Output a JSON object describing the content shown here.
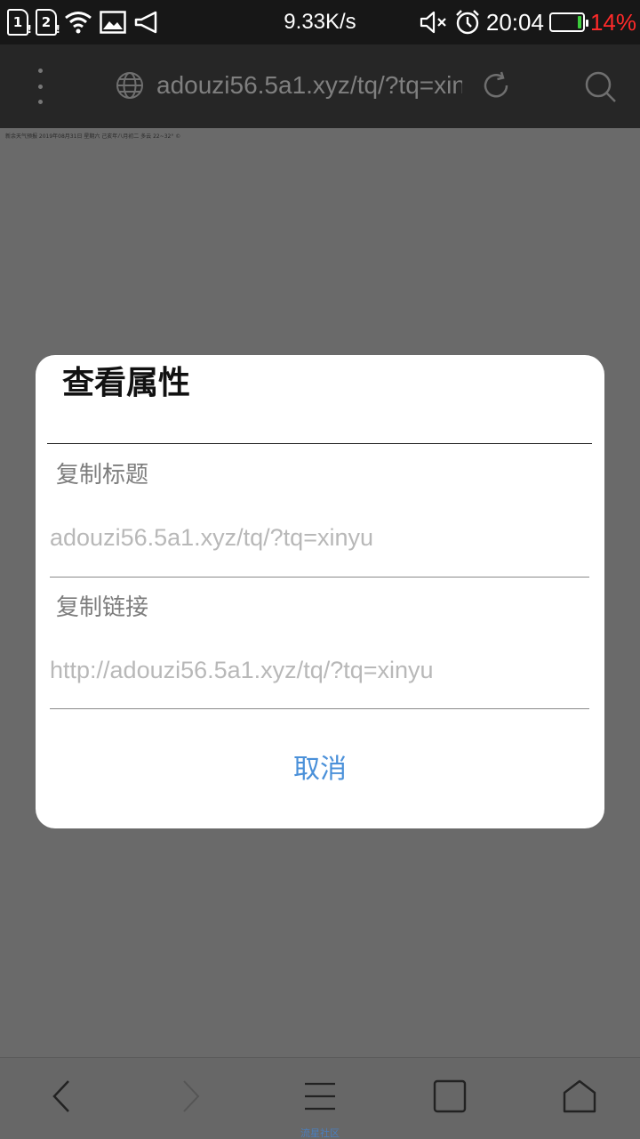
{
  "status_bar": {
    "sim1": "1",
    "sim2": "2",
    "net_speed": "9.33K/s",
    "time": "20:04",
    "battery_percent": "14%",
    "battery_level": 0.14,
    "battery_color": "#3ccc3c",
    "battery_text_color": "#ff2a2a",
    "icons": [
      "sim1-icon",
      "sim2-icon",
      "wifi-icon",
      "image-notification-icon",
      "megaphone-icon",
      "mute-icon",
      "alarm-icon",
      "battery-icon"
    ]
  },
  "toolbar": {
    "url": "adouzi56.5a1.xyz/tq/?tq=xinyu",
    "icons": [
      "menu-dots-icon",
      "globe-icon",
      "reload-icon",
      "search-icon"
    ]
  },
  "page": {
    "strip_text": "新余天气预报 2019年08月31日  星期六  己亥年八月初二 多云 22~32° ©"
  },
  "dialog": {
    "title": "查看属性",
    "copy_title_label": "复制标题",
    "copy_title_value": "adouzi56.5a1.xyz/tq/?tq=xinyu",
    "copy_link_label": "复制链接",
    "copy_link_value": "http://adouzi56.5a1.xyz/tq/?tq=xinyu",
    "cancel_label": "取消",
    "accent_color": "#4a90d9"
  },
  "bottom_nav": {
    "items": [
      "back-icon",
      "forward-icon",
      "menu-icon",
      "tabs-icon",
      "home-icon"
    ],
    "caption": "流星社区"
  }
}
